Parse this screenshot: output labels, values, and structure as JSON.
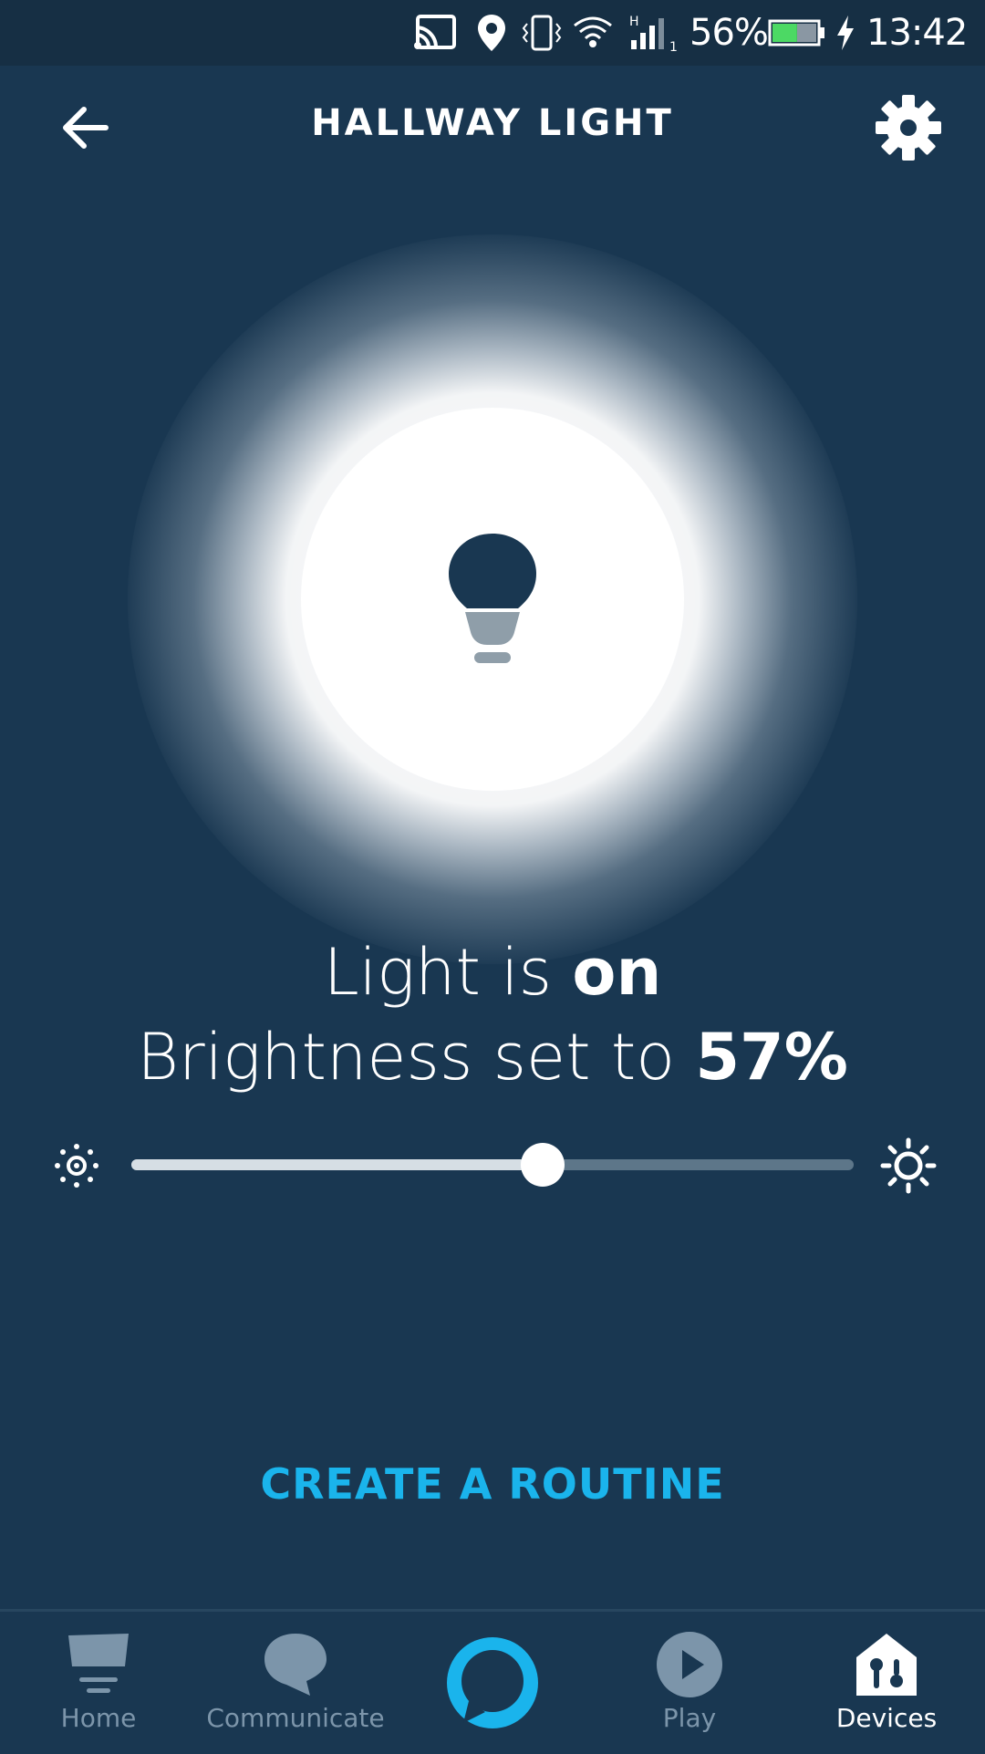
{
  "status_bar": {
    "battery_percent": "56%",
    "battery_level": 0.56,
    "time": "13:42",
    "network_type": "H",
    "sim_slot": "1"
  },
  "header": {
    "title": "HALLWAY LIGHT"
  },
  "light": {
    "state_prefix": "Light is ",
    "state_value": "on",
    "brightness_prefix": "Brightness set to ",
    "brightness_value": "57%",
    "brightness_level": 0.57
  },
  "actions": {
    "create_routine": "CREATE A ROUTINE"
  },
  "bottom_nav": {
    "items": [
      {
        "label": "Home",
        "icon": "home-icon",
        "active": false
      },
      {
        "label": "Communicate",
        "icon": "speech-bubble-icon",
        "active": false
      },
      {
        "label": "",
        "icon": "alexa-icon",
        "active": false
      },
      {
        "label": "Play",
        "icon": "play-icon",
        "active": false
      },
      {
        "label": "Devices",
        "icon": "devices-icon",
        "active": true
      }
    ]
  },
  "colors": {
    "background": "#193751",
    "accent": "#1ab4ec",
    "inactive_nav": "#7c95aa"
  }
}
